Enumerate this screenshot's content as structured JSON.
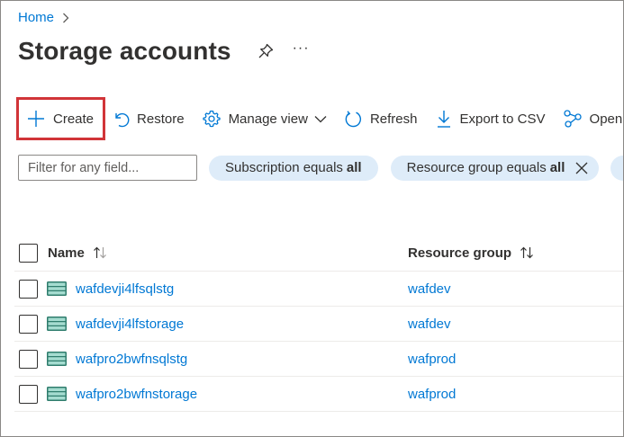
{
  "breadcrumb": {
    "home": "Home"
  },
  "page": {
    "title": "Storage accounts",
    "more": "···"
  },
  "toolbar": {
    "create": "Create",
    "restore": "Restore",
    "manage_view": "Manage view",
    "refresh": "Refresh",
    "export": "Export to CSV",
    "open": "Open query"
  },
  "filters": {
    "placeholder": "Filter for any field...",
    "subscription_label": "Subscription equals",
    "subscription_value": "all",
    "resource_group_label": "Resource group equals",
    "resource_group_value": "all"
  },
  "table": {
    "columns": {
      "name": "Name",
      "resource_group": "Resource group"
    },
    "rows": [
      {
        "name": "wafdevji4lfsqlstg",
        "resource_group": "wafdev"
      },
      {
        "name": "wafdevji4lfstorage",
        "resource_group": "wafdev"
      },
      {
        "name": "wafpro2bwfnsqlstg",
        "resource_group": "wafprod"
      },
      {
        "name": "wafpro2bwfnstorage",
        "resource_group": "wafprod"
      }
    ]
  },
  "icons": {
    "storage": "storage-account-icon",
    "create": "plus-icon",
    "restore": "undo-icon",
    "manage": "gear-icon",
    "refresh": "refresh-icon",
    "export": "download-icon",
    "open": "query-icon"
  },
  "colors": {
    "accent": "#0078d4",
    "highlight": "#d13438",
    "pill": "#deecf9"
  }
}
